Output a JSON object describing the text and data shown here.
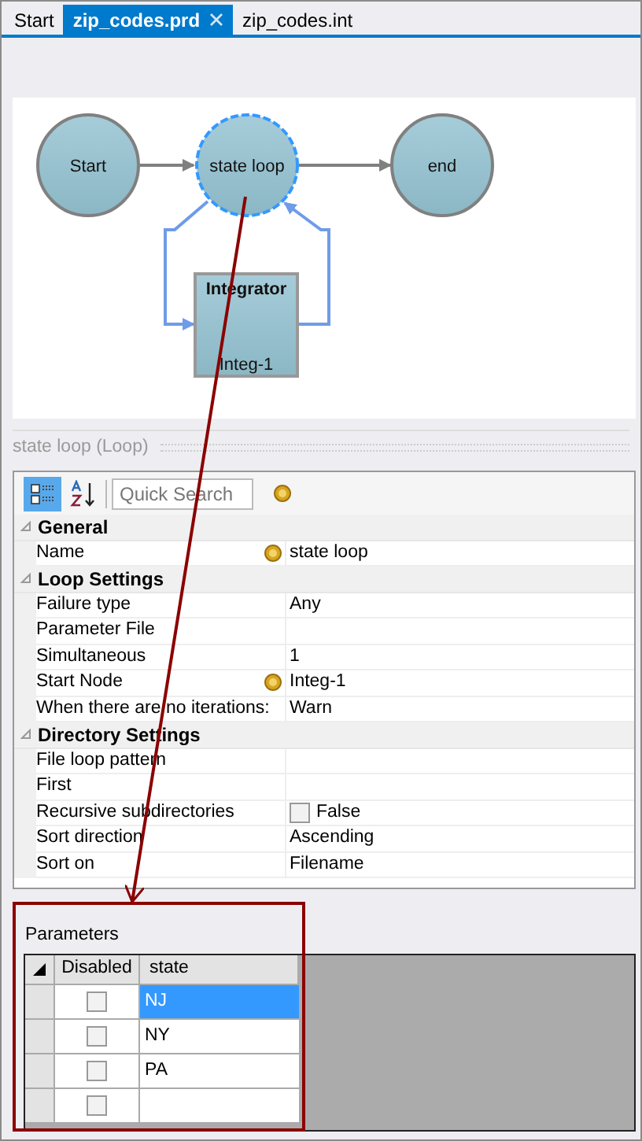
{
  "tabs": [
    {
      "label": "Start",
      "selected": false,
      "closable": false
    },
    {
      "label": "zip_codes.prd",
      "selected": true,
      "closable": true
    },
    {
      "label": "zip_codes.int",
      "selected": false,
      "closable": false
    }
  ],
  "diagram": {
    "nodes": [
      {
        "kind": "circle",
        "label": "Start",
        "selected": false
      },
      {
        "kind": "circle",
        "label": "state loop",
        "selected": true
      },
      {
        "kind": "circle",
        "label": "end",
        "selected": false
      },
      {
        "kind": "box",
        "title": "Integrator",
        "label": "Integ-1",
        "selected": false
      }
    ]
  },
  "properties": {
    "title": "state loop (Loop)",
    "search": {
      "placeholder": "Quick Search"
    },
    "rows": [
      {
        "kind": "category",
        "label": "General",
        "expanded": true
      },
      {
        "kind": "property",
        "label": "Name",
        "value": "state loop",
        "badge": true
      },
      {
        "kind": "category",
        "label": "Loop Settings",
        "expanded": true
      },
      {
        "kind": "property",
        "label": "Failure type",
        "value": "Any",
        "badge": false
      },
      {
        "kind": "property",
        "label": "Parameter File",
        "badge": false
      },
      {
        "kind": "property",
        "label": "Simultaneous",
        "value": "1",
        "badge": false
      },
      {
        "kind": "property",
        "label": "Start Node",
        "value": "Integ-1",
        "badge": true
      },
      {
        "kind": "property",
        "label": "When there are no iterations:",
        "value": "Warn",
        "badge": false
      },
      {
        "kind": "category",
        "label": "Directory Settings",
        "expanded": true
      },
      {
        "kind": "property",
        "label": "File loop pattern",
        "badge": false
      },
      {
        "kind": "property",
        "label": "First",
        "badge": false
      },
      {
        "kind": "checkbox",
        "label": "Recursive subdirectories",
        "value": "False",
        "checked": false
      },
      {
        "kind": "property",
        "label": "Sort direction",
        "value": "Ascending",
        "badge": false
      },
      {
        "kind": "property",
        "label": "Sort on",
        "value": "Filename",
        "badge": false
      }
    ]
  },
  "parameters": {
    "title": "Parameters",
    "columns": [
      "Disabled",
      "state"
    ],
    "rows": [
      {
        "disabled": false,
        "state": "NJ",
        "selected": true
      },
      {
        "disabled": false,
        "state": "NY",
        "selected": false
      },
      {
        "disabled": false,
        "state": "PA",
        "selected": false
      },
      {
        "disabled": false,
        "selected": false
      }
    ]
  }
}
